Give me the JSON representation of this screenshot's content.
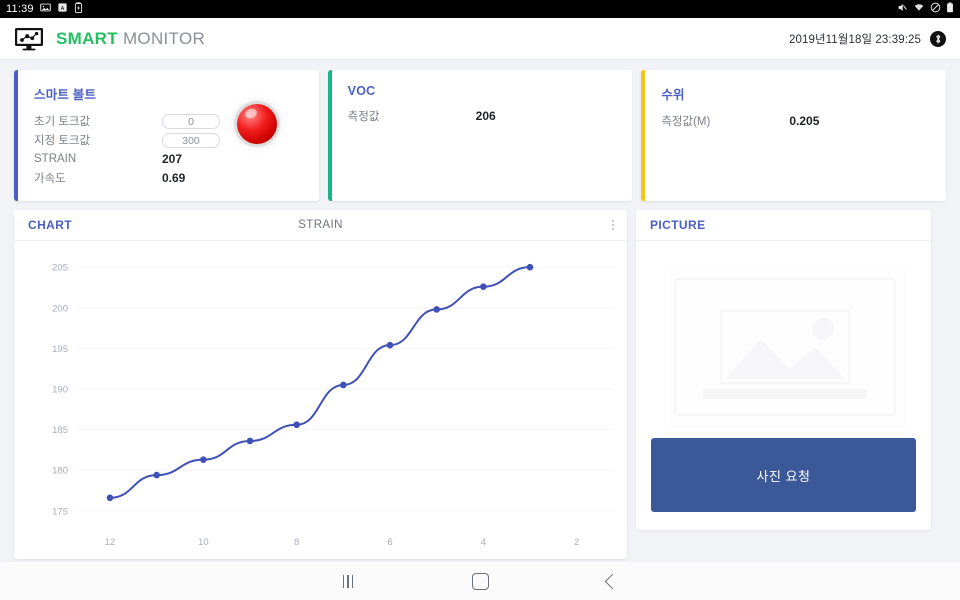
{
  "statusbar": {
    "clock": "11:39",
    "left_icons": [
      "image-icon",
      "pdf-icon",
      "battery-saver-icon"
    ],
    "right_icons": [
      "mute-icon",
      "wifi-icon",
      "do-not-disturb-icon",
      "battery-icon"
    ]
  },
  "header": {
    "logo_icon": "monitor-chart-icon",
    "title_smart": "SMART",
    "title_monitor": " MONITOR",
    "datetime": "2019년11월18일 23:39:25",
    "bluetooth_icon": "bluetooth-icon"
  },
  "cards": [
    {
      "title": "스마트 볼트",
      "accent": "#4a5fc1",
      "rows": [
        {
          "label": "초기 토크값",
          "value": "0",
          "type": "input"
        },
        {
          "label": "지정 토크값",
          "value": "300",
          "type": "input"
        },
        {
          "label": "STRAIN",
          "value": "207",
          "type": "text"
        },
        {
          "label": "가속도",
          "value": "0.69",
          "type": "text"
        }
      ],
      "indicator": {
        "name": "status-led",
        "color": "#f32020",
        "state": "red"
      }
    },
    {
      "title": "VOC",
      "accent": "#12b886",
      "rows": [
        {
          "label": "측정값",
          "value": "206",
          "type": "text"
        }
      ]
    },
    {
      "title": "수위",
      "accent": "#f5c518",
      "rows": [
        {
          "label": "측정값(M)",
          "value": "0.205",
          "type": "text"
        }
      ]
    }
  ],
  "chart_panel": {
    "title": "CHART",
    "center_label": "STRAIN",
    "menu_icon": "kebab-menu-icon"
  },
  "picture_panel": {
    "title": "PICTURE",
    "placeholder_icon": "image-placeholder-icon",
    "button_label": "사진 요청"
  },
  "navbar": {
    "recents_label": "recents-icon",
    "home_label": "home-icon",
    "back_label": "back-icon"
  },
  "chart_data": {
    "type": "line",
    "title": "STRAIN",
    "xlabel": "",
    "ylabel": "",
    "series": [
      {
        "name": "STRAIN",
        "color": "#3f51b5",
        "x": [
          12,
          11,
          10,
          9,
          8,
          7,
          6,
          5,
          4,
          3
        ],
        "values": [
          176.6,
          179.4,
          181.3,
          183.6,
          185.6,
          190.5,
          195.4,
          199.8,
          202.6,
          205.0
        ]
      }
    ],
    "x_ticks": [
      12,
      10,
      8,
      6,
      4,
      2
    ],
    "y_ticks": [
      175,
      180,
      185,
      190,
      195,
      200,
      205
    ],
    "ylim": [
      173.5,
      206.5
    ],
    "xlim": [
      12.6,
      1.2
    ],
    "grid": true,
    "legend": false,
    "marker": "circle"
  }
}
